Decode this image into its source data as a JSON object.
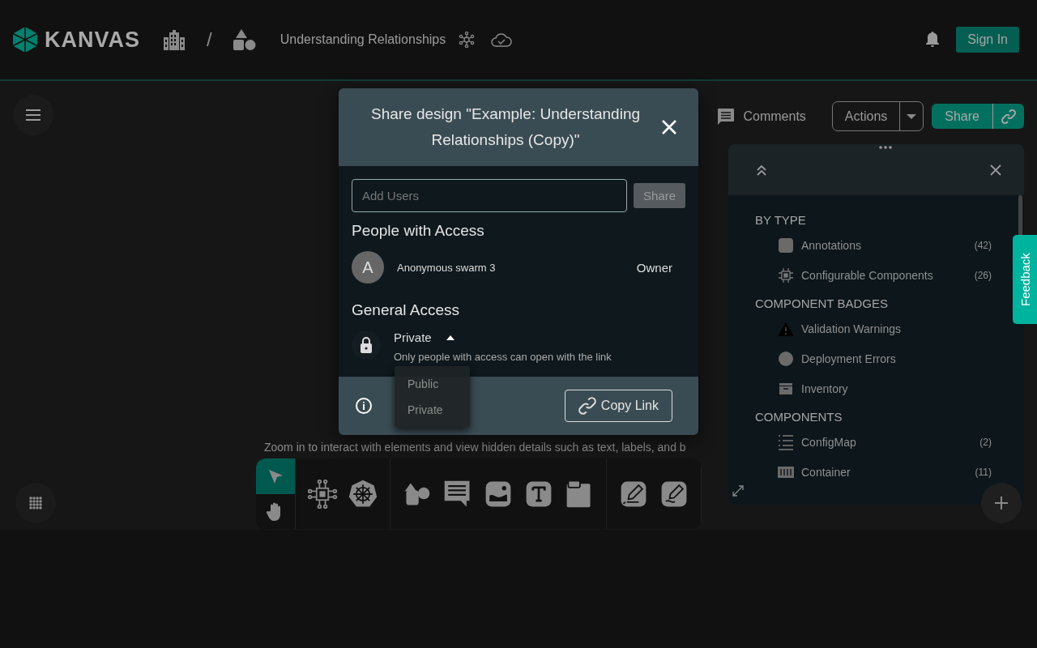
{
  "header": {
    "logo": "KANVAS",
    "separator": "/",
    "design_name": "Understanding Relationships",
    "sign_in": "Sign In"
  },
  "canvas_toolbar": {
    "comments": "Comments",
    "actions": "Actions",
    "share": "Share"
  },
  "hint": "Zoom in to interact with elements and view hidden details such as text, labels, and b",
  "tools": [
    {
      "kind": "select",
      "selected": true
    },
    {
      "kind": "pan",
      "selected": false
    }
  ],
  "share_dialog": {
    "title": "Share design \"Example: Understanding Relationships (Copy)\"",
    "add_users": {
      "placeholder": "Add Users"
    },
    "share_button": "Share",
    "people_heading": "People with Access",
    "people": [
      {
        "initial": "A",
        "name": "Anonymous swarm 3",
        "role": "Owner"
      }
    ],
    "general_heading": "General Access",
    "access": {
      "value": "Private",
      "description": "Only people with access can open with the link",
      "expanded": true
    },
    "access_options": [
      {
        "label": "Public"
      },
      {
        "label": "Private"
      }
    ],
    "copy_link": "Copy Link"
  },
  "layers_panel": {
    "sections": [
      {
        "heading": "BY TYPE",
        "items": [
          {
            "label": "Annotations",
            "count": "(42)"
          },
          {
            "label": "Configurable Components",
            "count": "(26)"
          }
        ]
      },
      {
        "heading": "COMPONENT BADGES",
        "items": [
          {
            "label": "Validation Warnings"
          },
          {
            "label": "Deployment Errors"
          },
          {
            "label": "Inventory"
          }
        ]
      },
      {
        "heading": "COMPONENTS",
        "items": [
          {
            "label": "ConfigMap",
            "count": "(2)"
          },
          {
            "label": "Container",
            "count": "(11)"
          }
        ]
      }
    ]
  },
  "feedback": "Feedback"
}
